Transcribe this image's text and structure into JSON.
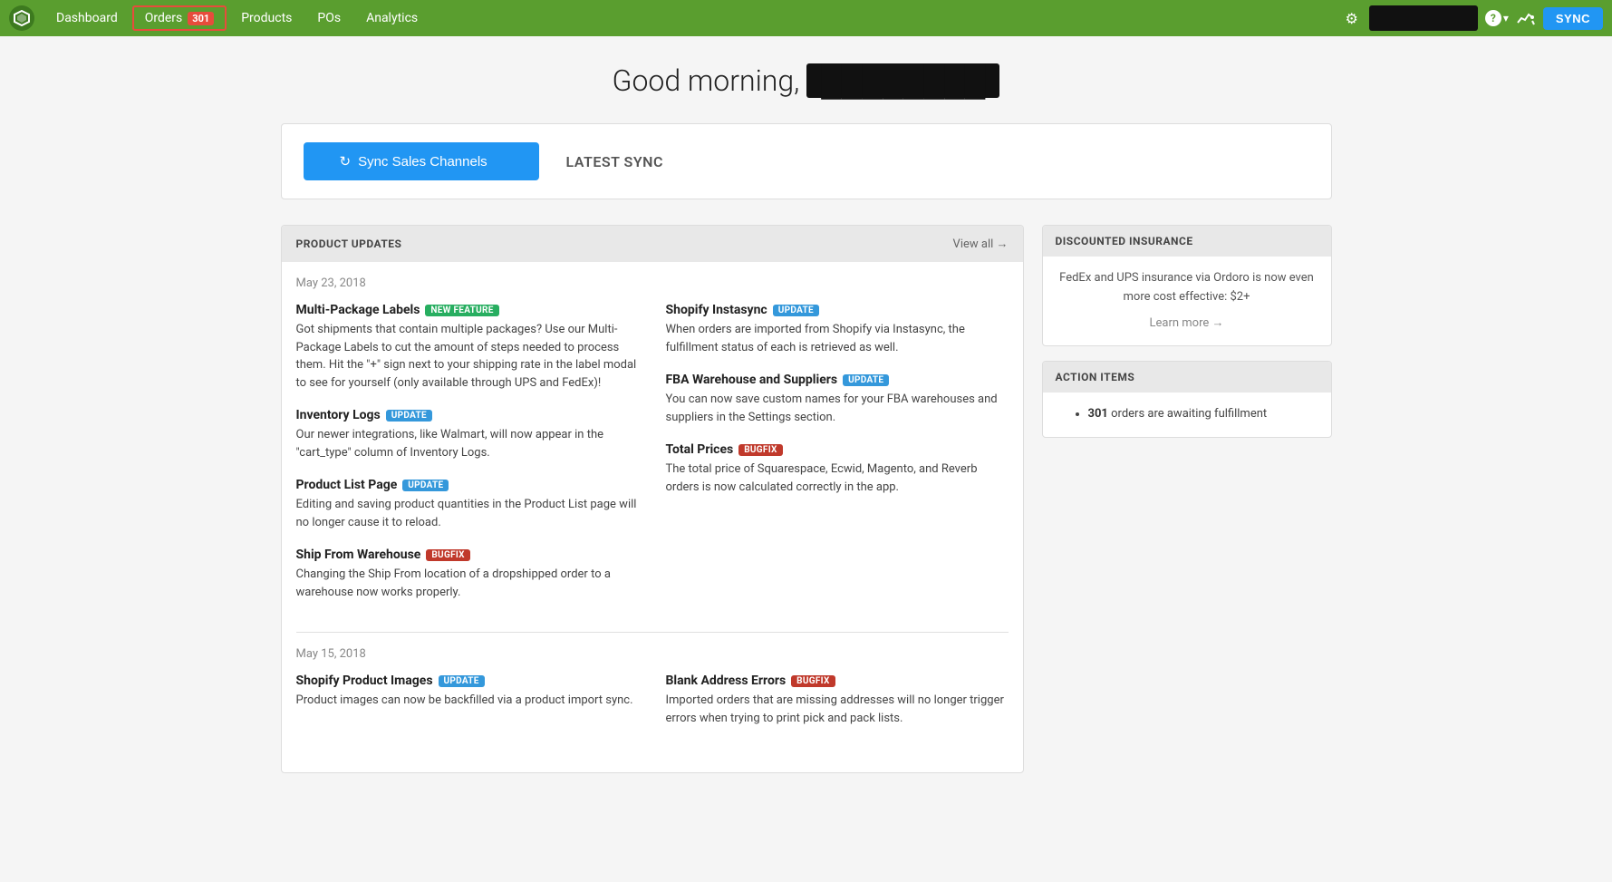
{
  "navbar": {
    "logo_symbol": "O",
    "items": [
      {
        "id": "dashboard",
        "label": "Dashboard",
        "active": false,
        "badge": null
      },
      {
        "id": "orders",
        "label": "Orders",
        "active": true,
        "badge": "301"
      },
      {
        "id": "products",
        "label": "Products",
        "active": false,
        "badge": null
      },
      {
        "id": "pos",
        "label": "POs",
        "active": false,
        "badge": null
      },
      {
        "id": "analytics",
        "label": "Analytics",
        "active": false,
        "badge": null
      }
    ],
    "sync_button_label": "SYNC",
    "help_label": "?",
    "settings_icon": "⚙",
    "analytics_icon": "⚡"
  },
  "greeting": {
    "prefix": "Good morning,",
    "name": "████████"
  },
  "sync_panel": {
    "button_label": "Sync Sales Channels",
    "latest_sync_label": "LATEST SYNC"
  },
  "product_updates": {
    "section_title": "PRODUCT UPDATES",
    "view_all_label": "View all →",
    "groups": [
      {
        "date": "May 23, 2018",
        "items": [
          {
            "title": "Multi-Package Labels",
            "tag": "NEW FEATURE",
            "tag_type": "new-feature",
            "text": "Got shipments that contain multiple packages? Use our Multi-Package Labels to cut the amount of steps needed to process them. Hit the \"+\" sign next to your shipping rate in the label modal to see for yourself (only available through UPS and FedEx)!"
          },
          {
            "title": "Shopify Instasync",
            "tag": "UPDATE",
            "tag_type": "update",
            "text": "When orders are imported from Shopify via Instasync, the fulfillment status of each is retrieved as well."
          },
          {
            "title": "Inventory Logs",
            "tag": "UPDATE",
            "tag_type": "update",
            "text": "Our newer integrations, like Walmart, will now appear in the \"cart_type\" column of Inventory Logs."
          },
          {
            "title": "FBA Warehouse and Suppliers",
            "tag": "UPDATE",
            "tag_type": "update",
            "text": "You can now save custom names for your FBA warehouses and suppliers in the Settings section."
          },
          {
            "title": "Product List Page",
            "tag": "UPDATE",
            "tag_type": "update",
            "text": "Editing and saving product quantities in the Product List page will no longer cause it to reload."
          },
          {
            "title": "Total Prices",
            "tag": "BUGFIX",
            "tag_type": "bugfix",
            "text": "The total price of Squarespace, Ecwid, Magento, and Reverb orders is now calculated correctly in the app."
          },
          {
            "title": "Ship From Warehouse",
            "tag": "BUGFIX",
            "tag_type": "bugfix",
            "text": "Changing the Ship From location of a dropshipped order to a warehouse now works properly."
          }
        ]
      },
      {
        "date": "May 15, 2018",
        "items": [
          {
            "title": "Shopify Product Images",
            "tag": "UPDATE",
            "tag_type": "update",
            "text": "Product images can now be backfilled via a product import sync."
          },
          {
            "title": "Blank Address Errors",
            "tag": "BUGFIX",
            "tag_type": "bugfix",
            "text": "Imported orders that are missing addresses will no longer trigger errors when trying to print pick and pack lists."
          }
        ]
      }
    ]
  },
  "sidebar": {
    "insurance": {
      "title": "DISCOUNTED INSURANCE",
      "body": "FedEx and UPS insurance via Ordoro is now even more cost effective: $2+",
      "learn_more": "Learn more →"
    },
    "action_items": {
      "title": "ACTION ITEMS",
      "order_count": "301",
      "order_text": "orders are awaiting fulfillment"
    }
  }
}
